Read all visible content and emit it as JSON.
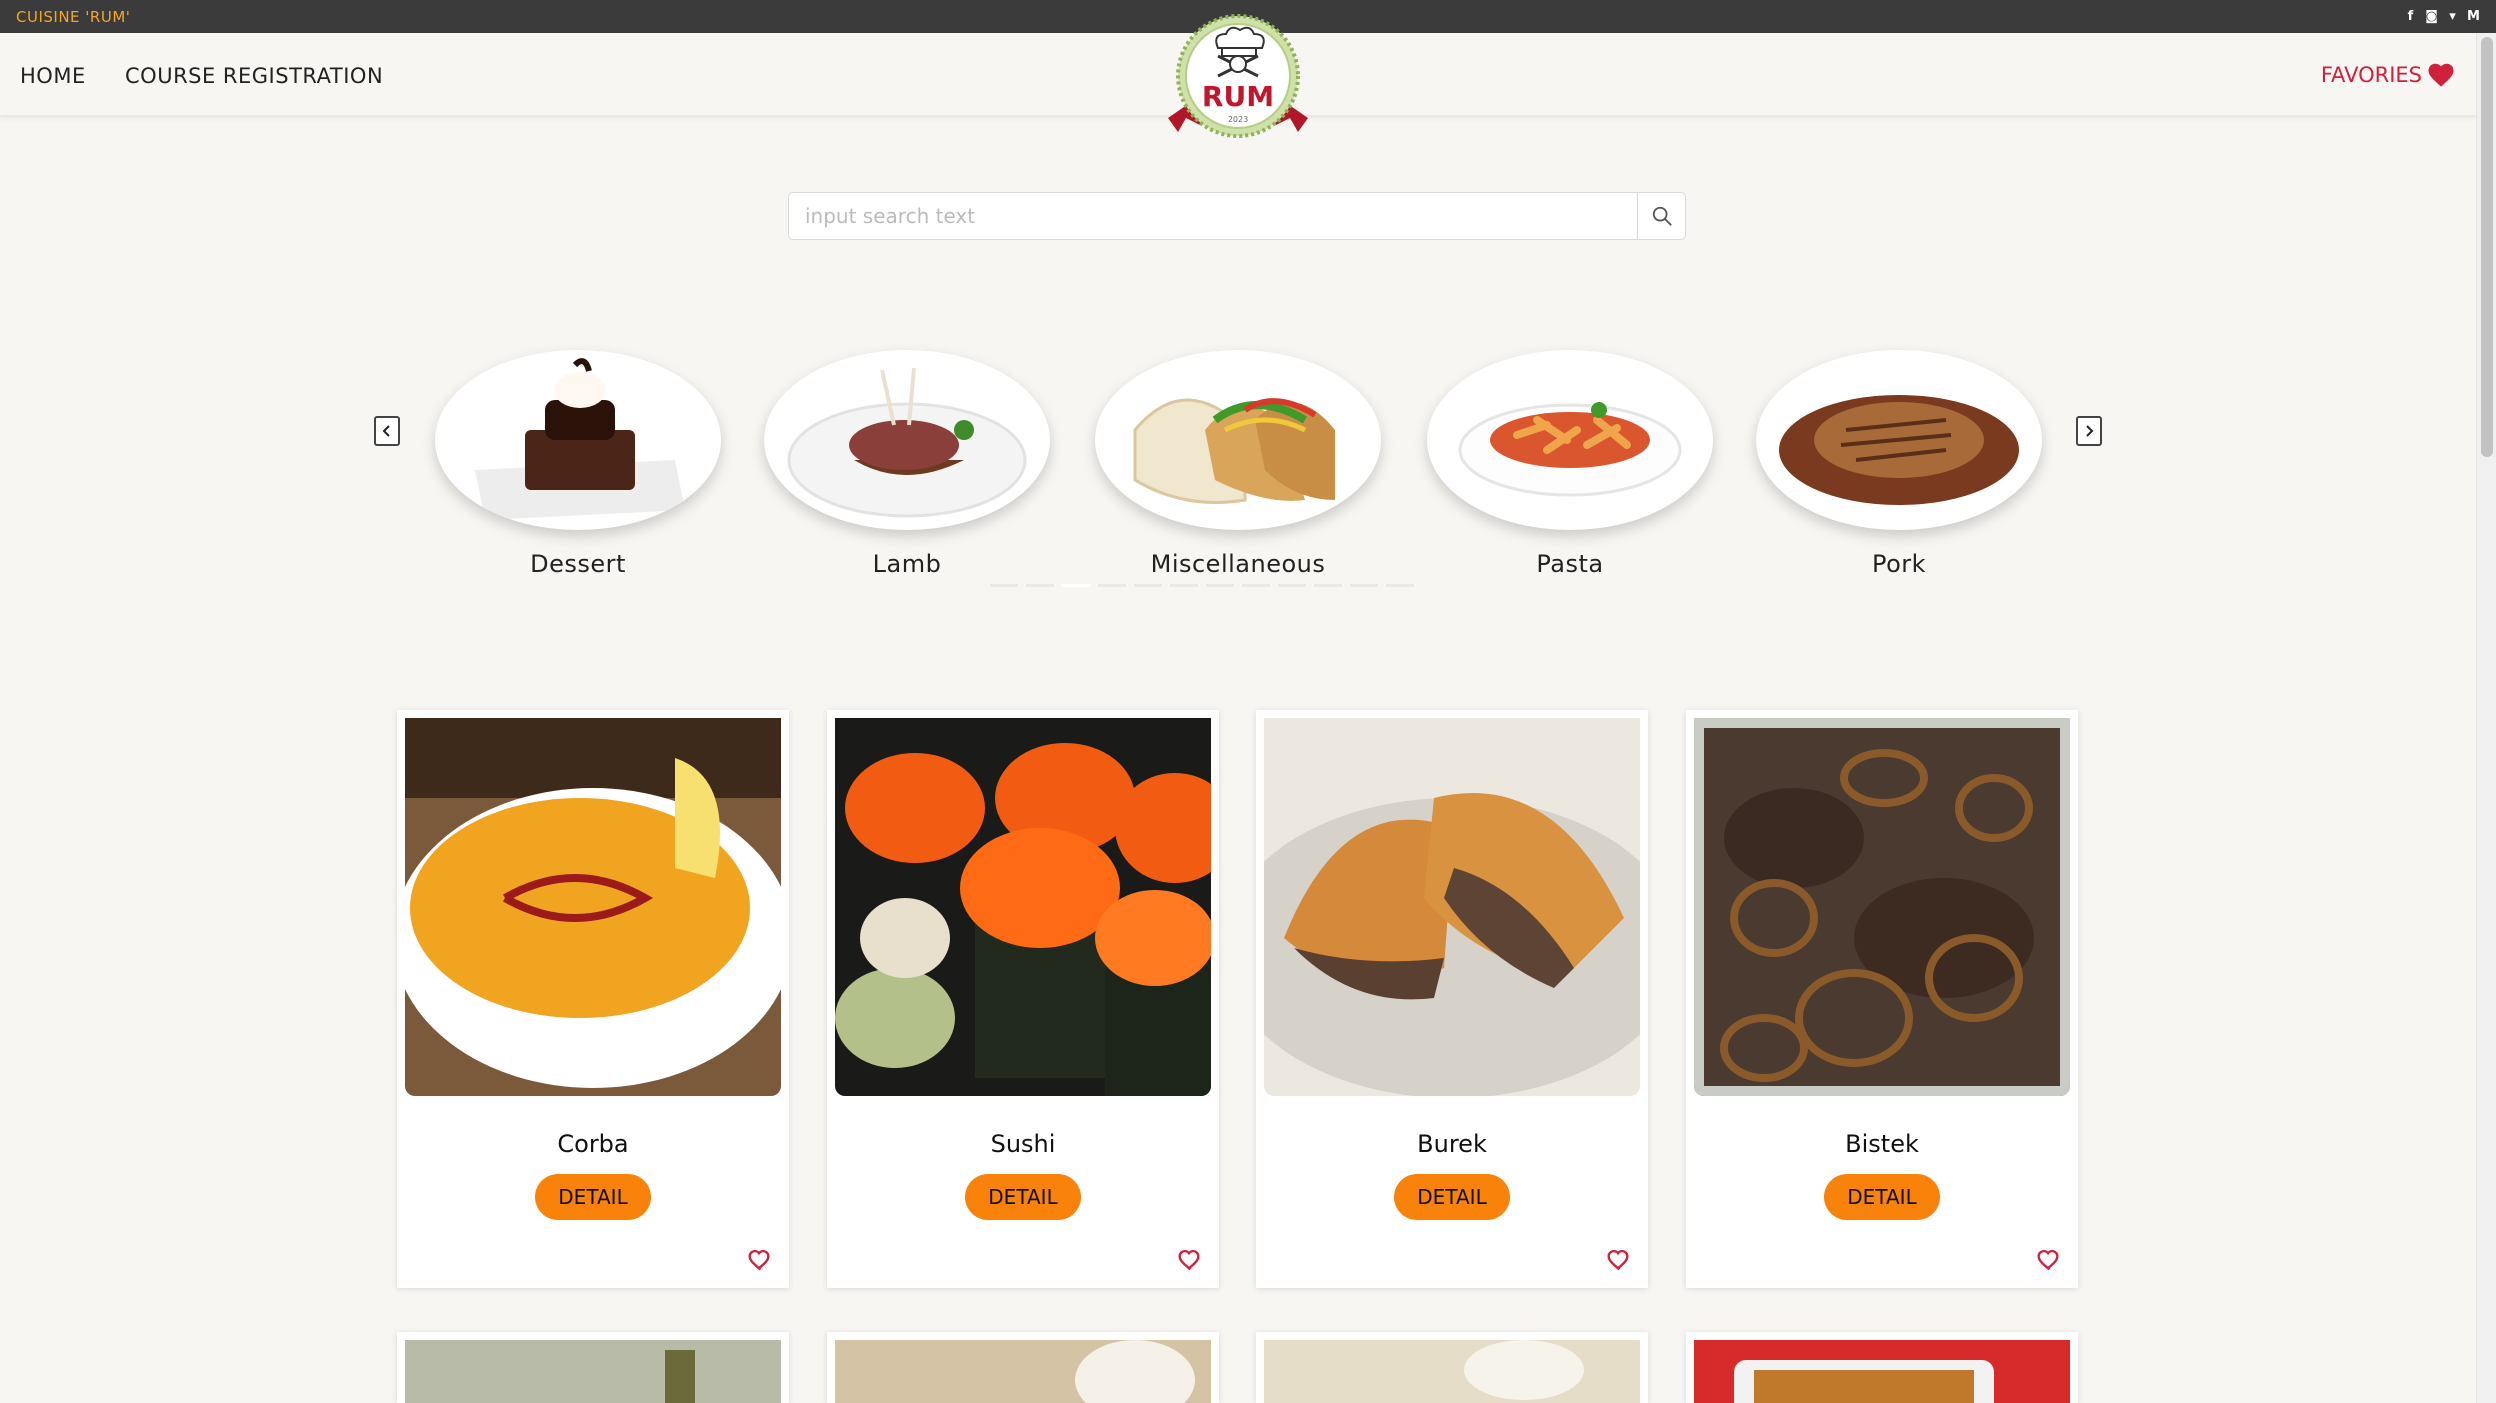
{
  "topbar": {
    "brand": "CUISINE 'RUM'",
    "socials": [
      "facebook-icon",
      "instagram-icon",
      "twitter-icon",
      "gmail-icon"
    ]
  },
  "nav": {
    "home": "HOME",
    "course": "COURSE REGISTRATION",
    "favorites": "FAVORIES"
  },
  "logo": {
    "text": "RUM",
    "year": "2023"
  },
  "search": {
    "placeholder": "input search text",
    "value": ""
  },
  "categories": [
    {
      "label": "Dessert"
    },
    {
      "label": "Lamb"
    },
    {
      "label": "Miscellaneous"
    },
    {
      "label": "Pasta"
    },
    {
      "label": "Pork"
    }
  ],
  "meals": [
    {
      "title": "Corba",
      "button": "DETAIL"
    },
    {
      "title": "Sushi",
      "button": "DETAIL"
    },
    {
      "title": "Burek",
      "button": "DETAIL"
    },
    {
      "title": "Bistek",
      "button": "DETAIL"
    }
  ],
  "colors": {
    "accent": "#f9820a",
    "favorite": "#d0203a",
    "brand": "#f5a623",
    "topbar": "#3b3b3b",
    "background": "#f8f6f2"
  }
}
